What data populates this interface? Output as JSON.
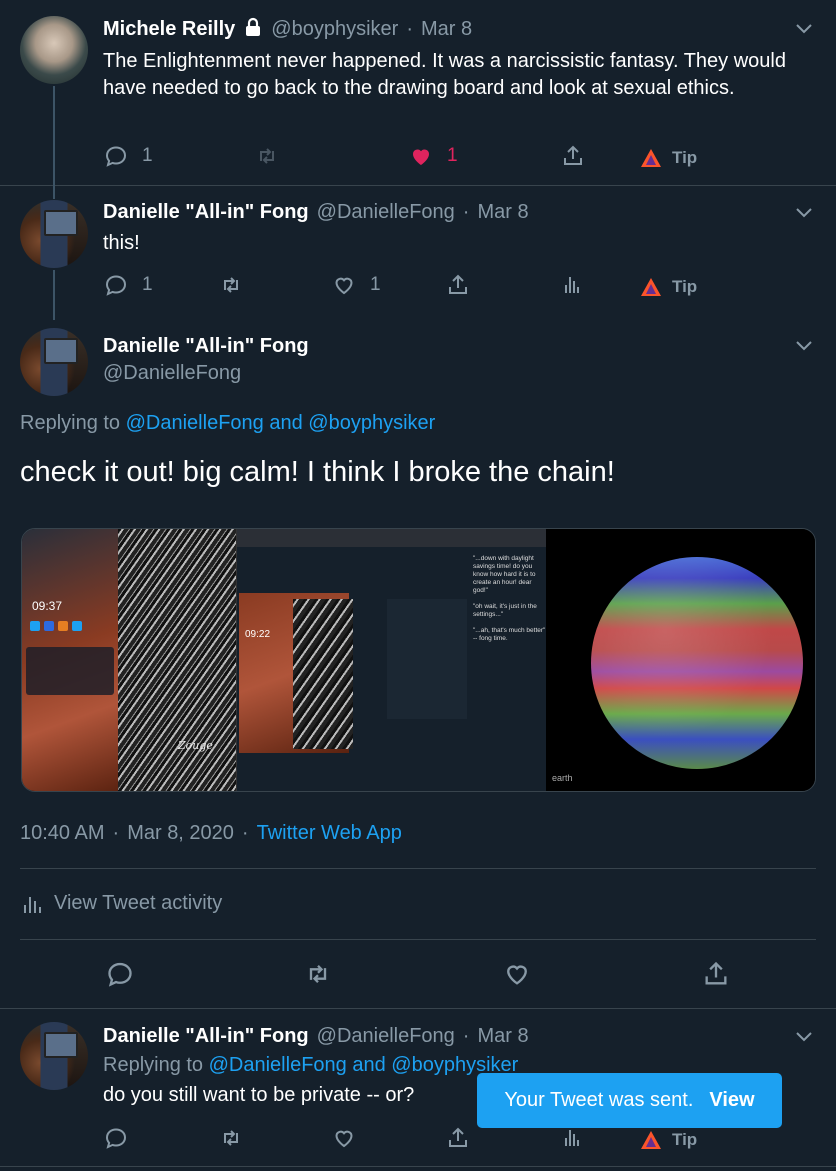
{
  "tweets": [
    {
      "name": "Michele Reilly",
      "handle": "@boyphysiker",
      "date": "Mar 8",
      "text": "The Enlightenment never happened. It was a narcissistic fantasy. They would have needed to go back to the drawing board and look at sexual ethics.",
      "reply_count": "1",
      "like_count": "1",
      "tip_label": "Tip",
      "liked": true
    },
    {
      "name": "Danielle \"All-in\" Fong",
      "handle": "@DanielleFong",
      "date": "Mar 8",
      "text": "this!",
      "reply_count": "1",
      "like_count": "1",
      "tip_label": "Tip"
    }
  ],
  "main_tweet": {
    "name": "Danielle \"All-in\" Fong",
    "handle": "@DanielleFong",
    "replying_prefix": "Replying to",
    "reply_to_1": "@DanielleFong",
    "reply_and": "and",
    "reply_to_2": "@boyphysiker",
    "text": "check it out! big calm! I think I broke the chain!",
    "time": "10:40 AM",
    "date": "Mar 8, 2020",
    "source": "Twitter Web App",
    "activity_label": "View Tweet activity",
    "media": {
      "phone_time": "09:37",
      "phone_time_2": "09:22",
      "sidebar_text": "\"...down with daylight savings time! do you know how hard it is to create an hour! dear god!\"",
      "sidebar_text_2": "\"oh wait, it's just in the settings...\"",
      "sidebar_text_3": "\"...ah, that's much better\" -- fong time.",
      "globe_label": "earth",
      "art_caption": "Zouge"
    }
  },
  "reply_tweet": {
    "name": "Danielle \"All-in\" Fong",
    "handle": "@DanielleFong",
    "date": "Mar 8",
    "replying_prefix": "Replying to",
    "reply_to_1": "@DanielleFong",
    "reply_and": "and",
    "reply_to_2": "@boyphysiker",
    "text": "do you still want to be private -- or?",
    "tip_label": "Tip"
  },
  "toast": {
    "message": "Your Tweet was sent.",
    "action": "View"
  },
  "colors": {
    "background": "#15202b",
    "accent": "#1da1f2",
    "secondary_text": "#8899a6",
    "like": "#e0245e"
  }
}
